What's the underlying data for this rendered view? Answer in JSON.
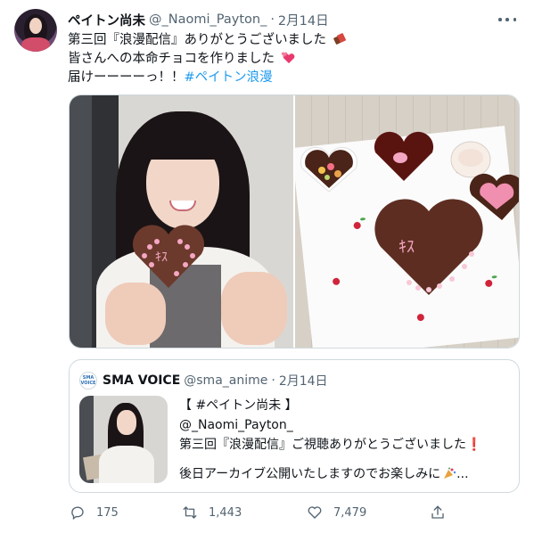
{
  "tweet": {
    "display_name": "ペイトン尚未",
    "handle": "@_Naomi_Payton_",
    "separator": "·",
    "date": "2月14日",
    "lines": {
      "l1": "第三回『浪漫配信』ありがとうございました",
      "l2": "皆さんへの本命チョコを作りました",
      "l3_prefix": "届けーーーーっ！！",
      "l3_hashtag": "#ペイトン浪漫"
    },
    "emoji": {
      "l1": "chocolate-bar-icon",
      "l2": "two-hearts-icon"
    }
  },
  "media": {
    "photos": [
      {
        "name": "photo-girl-holding-heart-chocolate"
      },
      {
        "name": "photo-heart-chocolates-on-cherry-plate"
      }
    ]
  },
  "quote": {
    "avatar_text": "SMA VOICE",
    "display_name": "SMA VOICE",
    "handle": "@sma_anime",
    "separator": "·",
    "date": "2月14日",
    "lines": {
      "l1": "【 #ペイトン尚未 】",
      "l2": "@_Naomi_Payton_",
      "l3": "第三回『浪漫配信』ご視聴ありがとうございました",
      "l3_mark": "❗",
      "l4": "後日アーカイブ公開いたしますのでお楽しみに",
      "l4_tail": "..."
    }
  },
  "actions": {
    "reply_count": "175",
    "retweet_count": "1,443",
    "like_count": "7,479"
  },
  "colors": {
    "link": "#1d9bf0",
    "secondary_text": "#536471",
    "border": "#cfd9de"
  }
}
